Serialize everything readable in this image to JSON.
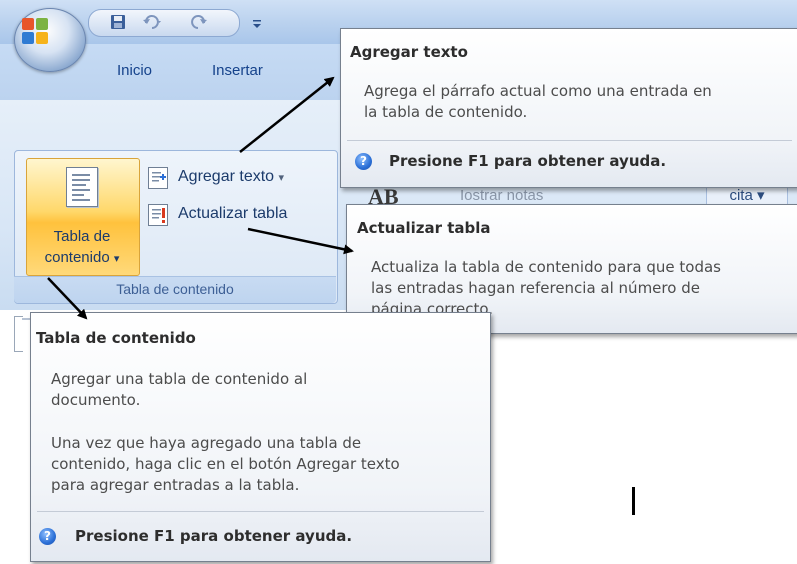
{
  "quick_access": {
    "office_button_icon": "office-logo-icon",
    "save_icon": "save-icon",
    "undo_icon": "undo-icon",
    "redo_icon": "redo-icon",
    "customize_icon": "customize-qa-icon"
  },
  "ribbon": {
    "tabs": [
      "Inicio",
      "Insertar"
    ],
    "group": {
      "label": "Tabla de contenido",
      "toc_button_label_line1": "Tabla de",
      "toc_button_label_line2": "contenido",
      "dropdown_glyph": "▾",
      "add_text_label": "Agregar texto",
      "add_text_glyph": "▾",
      "update_table_label": "Actualizar tabla"
    },
    "partial": {
      "ab_text": "AB",
      "mostrar_notas": "Iostrar notas",
      "cita_label": "cita ▾"
    }
  },
  "tooltips": {
    "agregar_texto": {
      "title": "Agregar texto",
      "body_line1": "Agrega el párrafo actual como una entrada en",
      "body_line2": "la tabla de contenido.",
      "help": "Presione F1 para obtener ayuda."
    },
    "actualizar_tabla": {
      "title": "Actualizar tabla",
      "body_line1": "Actualiza la tabla de contenido para que todas",
      "body_line2": "las entradas hagan referencia al número de",
      "body_line3": "página correcto."
    },
    "tabla_contenido": {
      "title": "Tabla de contenido",
      "p1_line1": "Agregar una tabla de contenido al",
      "p1_line2": "documento.",
      "p2_line1": "Una vez que haya agregado una tabla de",
      "p2_line2": "contenido, haga clic en el botón Agregar texto",
      "p2_line3": "para agregar entradas a la tabla.",
      "help": "Presione F1 para obtener ayuda."
    }
  },
  "help_icon_glyph": "?",
  "colors": {
    "accent_orange": "#ffc23d",
    "ribbon_blue": "#c6dbf4",
    "text_blue": "#15428b",
    "arrow": "#000000"
  }
}
